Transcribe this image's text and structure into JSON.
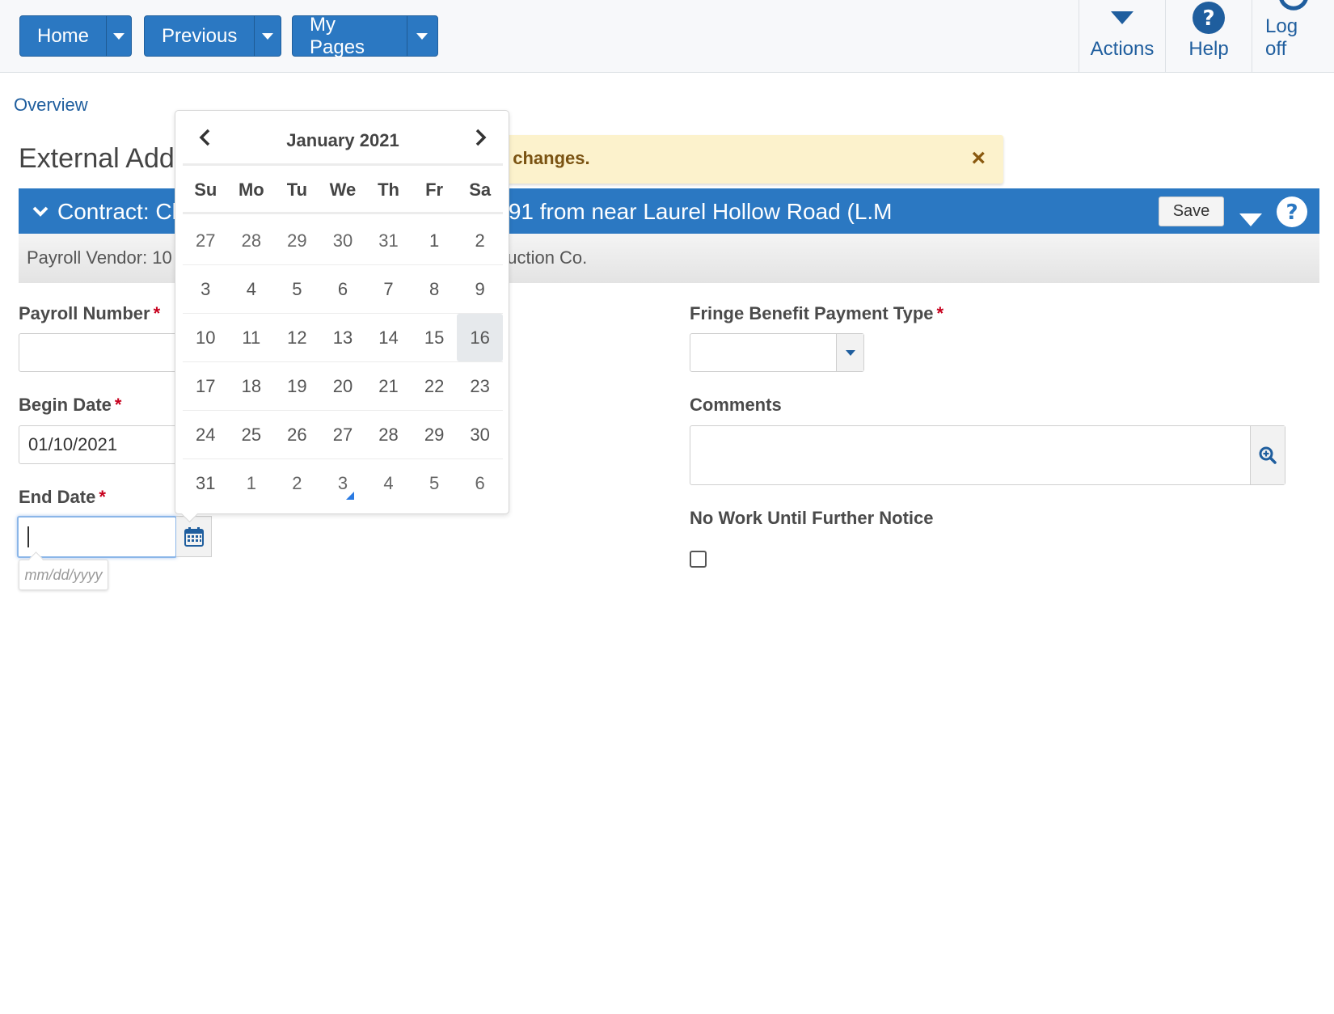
{
  "nav": {
    "home": "Home",
    "previous": "Previous",
    "my_pages": "My Pages",
    "actions": "Actions",
    "help": "Help",
    "logoff": "Log off"
  },
  "breadcrumb": "Overview",
  "page_title": "External Add",
  "alert": {
    "message": "l changes.",
    "close": "×"
  },
  "panel": {
    "title": "Contract: Cl                               91 from near Laurel Hollow Road (L.M",
    "title_left": "Contract: Cl",
    "title_right": "91 from near Laurel Hollow Road (L.M",
    "save": "Save",
    "sub_left": "Payroll Vendor: 10",
    "sub_right": "struction Co."
  },
  "form": {
    "payroll_number_label": "Payroll Number",
    "payroll_number_value": "",
    "begin_date_label": "Begin Date",
    "begin_date_value": "01/10/2021",
    "end_date_label": "End Date",
    "end_date_value": "",
    "date_placeholder": "mm/dd/yyyy",
    "fringe_label": "Fringe Benefit Payment Type",
    "fringe_value": "",
    "comments_label": "Comments",
    "comments_value": "",
    "no_work_label": "No Work Until Further Notice",
    "no_work_checked": false
  },
  "calendar": {
    "month_label": "January 2021",
    "dow": [
      "Su",
      "Mo",
      "Tu",
      "We",
      "Th",
      "Fr",
      "Sa"
    ],
    "weeks": [
      [
        "27",
        "28",
        "29",
        "30",
        "31",
        "1",
        "2"
      ],
      [
        "3",
        "4",
        "5",
        "6",
        "7",
        "8",
        "9"
      ],
      [
        "10",
        "11",
        "12",
        "13",
        "14",
        "15",
        "16"
      ],
      [
        "17",
        "18",
        "19",
        "20",
        "21",
        "22",
        "23"
      ],
      [
        "24",
        "25",
        "26",
        "27",
        "28",
        "29",
        "30"
      ],
      [
        "31",
        "1",
        "2",
        "3",
        "4",
        "5",
        "6"
      ]
    ],
    "selected_day": "16",
    "today_marker_day": "3"
  },
  "colors": {
    "primary": "#2b78c2",
    "link": "#1f5e9e",
    "required": "#c7001d",
    "alert_bg": "#fcf2cc"
  }
}
